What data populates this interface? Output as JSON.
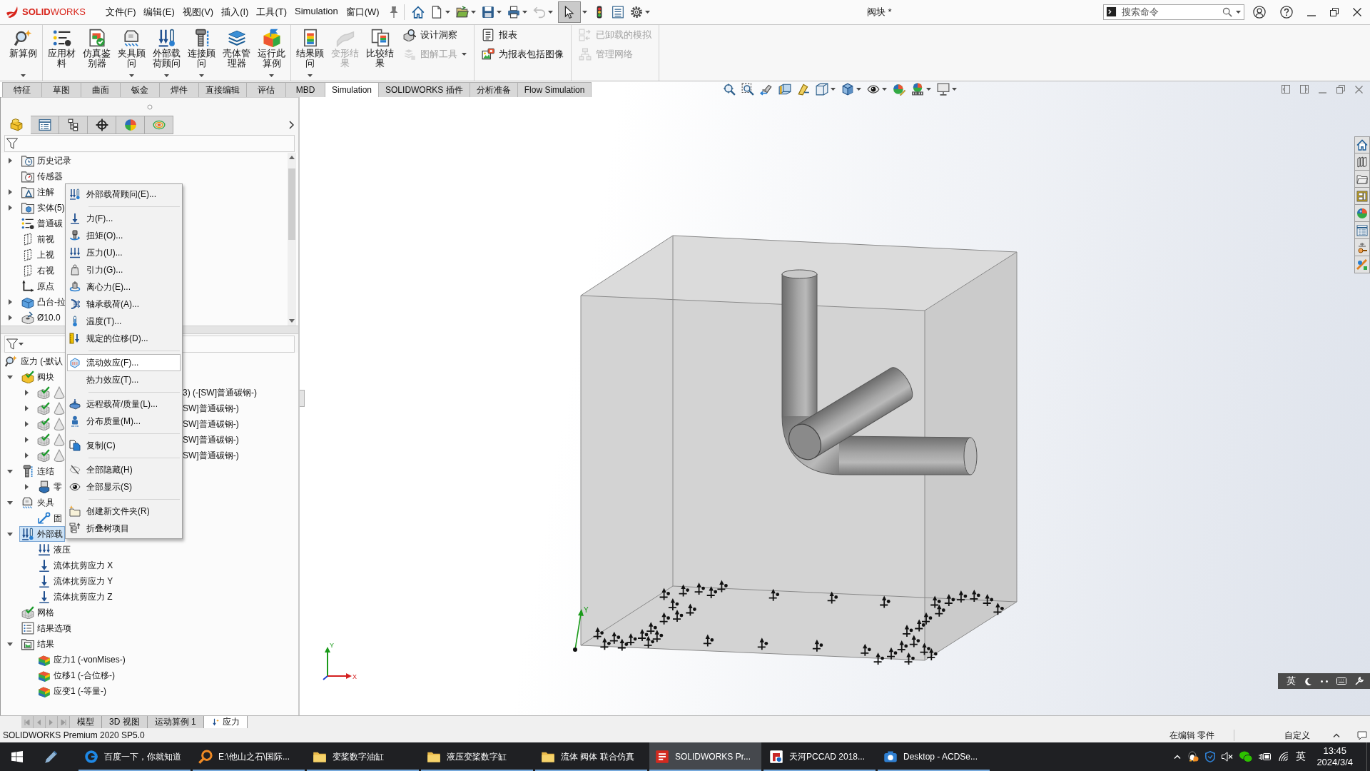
{
  "title_bar": {
    "logo": "**SOLID**WORKS",
    "menus": [
      "文件(F)",
      "编辑(E)",
      "视图(V)",
      "插入(I)",
      "工具(T)",
      "Simulation",
      "窗口(W)"
    ],
    "quick_access": [
      {
        "kind": "home",
        "dropdown": false,
        "disabled": false,
        "selected": false
      },
      {
        "kind": "new",
        "dropdown": true,
        "disabled": false,
        "selected": false
      },
      {
        "kind": "open",
        "dropdown": true,
        "disabled": false,
        "selected": false
      },
      {
        "kind": "save",
        "dropdown": true,
        "disabled": false,
        "selected": false
      },
      {
        "kind": "print",
        "dropdown": true,
        "disabled": false,
        "selected": false
      },
      {
        "kind": "undo",
        "dropdown": true,
        "disabled": true,
        "selected": false
      },
      {
        "kind": "select",
        "dropdown": true,
        "disabled": false,
        "selected": true
      },
      {
        "kind": "rebuild",
        "dropdown": false,
        "disabled": false,
        "selected": false
      },
      {
        "kind": "properties",
        "dropdown": false,
        "disabled": false,
        "selected": false
      },
      {
        "kind": "options",
        "dropdown": true,
        "disabled": false,
        "selected": false
      }
    ],
    "document_title": "阀块 *",
    "search": {
      "placeholder": "搜索命令"
    }
  },
  "ribbon": {
    "groups": [
      {
        "buttons": [
          {
            "label": "新算例",
            "kind": "study",
            "dropdown": true,
            "disabled": false
          }
        ]
      },
      {
        "buttons": [
          {
            "label": "应用材料",
            "kind": "material",
            "dropdown": false,
            "disabled": false
          },
          {
            "label": "仿真鉴别器",
            "kind": "evaluator",
            "dropdown": false,
            "disabled": false
          },
          {
            "label": "夹具顾问",
            "kind": "fixtures",
            "dropdown": true,
            "disabled": false
          },
          {
            "label": "外部载荷顾问",
            "kind": "loads",
            "dropdown": true,
            "disabled": false
          },
          {
            "label": "连接顾问",
            "kind": "connections",
            "dropdown": true,
            "disabled": false
          },
          {
            "label": "壳体管理器",
            "kind": "shells",
            "dropdown": false,
            "disabled": false
          },
          {
            "label": "运行此算例",
            "kind": "run",
            "dropdown": true,
            "disabled": false
          }
        ]
      },
      {
        "buttons": [
          {
            "label": "结果顾问",
            "kind": "resultsadvisor",
            "dropdown": true,
            "disabled": false
          },
          {
            "label": "变形结果",
            "kind": "deformed",
            "dropdown": false,
            "disabled": true
          },
          {
            "label": "比较结果",
            "kind": "compare",
            "dropdown": false,
            "disabled": false
          }
        ],
        "stack": [
          {
            "label": "设计洞察",
            "kind": "insight",
            "dropdown": false,
            "disabled": false
          },
          {
            "label": "图解工具",
            "kind": "plottools",
            "dropdown": true,
            "disabled": true
          }
        ]
      },
      {
        "stack": [
          {
            "label": "报表",
            "kind": "report",
            "dropdown": false,
            "disabled": false
          },
          {
            "label": "为报表包括图像",
            "kind": "image",
            "dropdown": false,
            "disabled": false
          }
        ]
      },
      {
        "stack": [
          {
            "label": "已卸载的模拟",
            "kind": "offloaded",
            "dropdown": false,
            "disabled": true
          },
          {
            "label": "管理网络",
            "kind": "network",
            "dropdown": false,
            "disabled": true
          }
        ]
      }
    ]
  },
  "command_tabs": [
    {
      "label": "特征",
      "selected": false
    },
    {
      "label": "草图",
      "selected": false
    },
    {
      "label": "曲面",
      "selected": false
    },
    {
      "label": "钣金",
      "selected": false
    },
    {
      "label": "焊件",
      "selected": false
    },
    {
      "label": "直接编辑",
      "selected": false
    },
    {
      "label": "评估",
      "selected": false
    },
    {
      "label": "MBD",
      "selected": false
    },
    {
      "label": "Simulation",
      "selected": true
    },
    {
      "label": "SOLIDWORKS 插件",
      "selected": false
    },
    {
      "label": "分析准备",
      "selected": false
    },
    {
      "label": "Flow Simulation",
      "selected": false
    }
  ],
  "feature_manager": {
    "tabs": [
      {
        "kind": "features",
        "selected": true
      },
      {
        "kind": "propertymanager",
        "selected": false
      },
      {
        "kind": "configurations",
        "selected": false
      },
      {
        "kind": "dimxpert",
        "selected": false
      },
      {
        "kind": "displaymanager",
        "selected": false
      },
      {
        "kind": "cam",
        "selected": false
      }
    ],
    "feature_tree": [
      {
        "label": "历史记录",
        "kind": "history",
        "expanded": false,
        "selected": false
      },
      {
        "label": "传感器",
        "kind": "sensors",
        "selected": false
      },
      {
        "label": "注解",
        "kind": "annotations",
        "expanded": false,
        "selected": false
      },
      {
        "label": "实体(5)",
        "kind": "bodies",
        "expanded": false,
        "selected": false
      },
      {
        "label": "普通碳",
        "kind": "material",
        "selected": false
      },
      {
        "label": "前视",
        "kind": "plane",
        "selected": false
      },
      {
        "label": "上视",
        "kind": "plane",
        "selected": false
      },
      {
        "label": "右视",
        "kind": "plane",
        "selected": false
      },
      {
        "label": "原点",
        "kind": "origin",
        "selected": false
      },
      {
        "label": "凸台-拉",
        "kind": "extrude",
        "expanded": false,
        "selected": false
      },
      {
        "label": "Ø10.0",
        "kind": "hole",
        "expanded": false,
        "selected": false
      }
    ],
    "study_tree": [
      {
        "label": "应力 (-默认",
        "kind": "study",
        "selected": false,
        "children": [
          {
            "label": "阀块",
            "kind": "part",
            "expanded": true,
            "selected": false,
            "children": [
              {
                "label": "3) (-[SW]普通碳钢-)",
                "kind": "body",
                "expanded": false,
                "selected": false
              },
              {
                "label": "SW]普通碳钢-)",
                "kind": "body",
                "expanded": false,
                "selected": false
              },
              {
                "label": "SW]普通碳钢-)",
                "kind": "body",
                "expanded": false,
                "selected": false
              },
              {
                "label": "SW]普通碳钢-)",
                "kind": "body",
                "expanded": false,
                "selected": false
              },
              {
                "label": "SW]普通碳钢-)",
                "kind": "body",
                "expanded": false,
                "selected": false
              }
            ]
          },
          {
            "label": "连结",
            "kind": "connections",
            "expanded": true,
            "selected": false,
            "children": [
              {
                "label": "零",
                "kind": "component",
                "expanded": false,
                "selected": false
              }
            ]
          },
          {
            "label": "夹具",
            "kind": "fixtures",
            "expanded": true,
            "selected": false,
            "children": [
              {
                "label": "固",
                "kind": "fixed",
                "selected": false
              }
            ]
          },
          {
            "label": "外部载",
            "kind": "loads",
            "expanded": true,
            "selected": true,
            "children": [
              {
                "label": "液压",
                "kind": "pressure",
                "selected": false
              },
              {
                "label": "流体抗剪应力 X",
                "kind": "force",
                "selected": false
              },
              {
                "label": "流体抗剪应力 Y",
                "kind": "force",
                "selected": false
              },
              {
                "label": "流体抗剪应力 Z",
                "kind": "force",
                "selected": false
              }
            ]
          },
          {
            "label": "网格",
            "kind": "mesh",
            "selected": false
          },
          {
            "label": "结果选项",
            "kind": "resultoptions",
            "selected": false
          },
          {
            "label": "结果",
            "kind": "results",
            "expanded": true,
            "selected": false,
            "children": [
              {
                "label": "应力1 (-vonMises-)",
                "kind": "plot",
                "selected": false
              },
              {
                "label": "位移1 (-合位移-)",
                "kind": "plot",
                "selected": false
              },
              {
                "label": "应变1 (-等量-)",
                "kind": "plot",
                "selected": false
              }
            ]
          }
        ]
      }
    ]
  },
  "context_menu": [
    {
      "label": "外部载荷顾问(E)...",
      "kind": "advisor",
      "selected": false
    },
    {
      "kind": "separator"
    },
    {
      "label": "力(F)...",
      "kind": "force",
      "selected": false
    },
    {
      "label": "扭矩(O)...",
      "kind": "torque",
      "selected": false
    },
    {
      "label": "压力(U)...",
      "kind": "pressure",
      "selected": false
    },
    {
      "label": "引力(G)...",
      "kind": "gravity",
      "selected": false
    },
    {
      "label": "离心力(E)...",
      "kind": "centrifugal",
      "selected": false
    },
    {
      "label": "轴承载荷(A)...",
      "kind": "bearing",
      "selected": false
    },
    {
      "label": "温度(T)...",
      "kind": "temperature",
      "selected": false
    },
    {
      "label": "规定的位移(D)...",
      "kind": "displacement",
      "selected": false
    },
    {
      "kind": "separator"
    },
    {
      "label": "流动效应(F)...",
      "kind": "flow",
      "selected": true
    },
    {
      "label": "热力效应(T)...",
      "kind": "thermal",
      "selected": false
    },
    {
      "kind": "separator"
    },
    {
      "label": "远程载荷/质量(L)...",
      "kind": "remote",
      "selected": false
    },
    {
      "label": "分布质量(M)...",
      "kind": "mass",
      "selected": false
    },
    {
      "kind": "separator"
    },
    {
      "label": "复制(C)",
      "kind": "copy",
      "selected": false
    },
    {
      "kind": "separator"
    },
    {
      "label": "全部隐藏(H)",
      "kind": "hide",
      "selected": false
    },
    {
      "label": "全部显示(S)",
      "kind": "show",
      "selected": false
    },
    {
      "kind": "separator"
    },
    {
      "label": "创建新文件夹(R)",
      "kind": "newfolder",
      "selected": false
    },
    {
      "label": "折叠树项目",
      "kind": "collapse",
      "selected": false
    }
  ],
  "viewport": {
    "reference_axis_label": "Y",
    "triad": {
      "x_label": "X",
      "y_label": "Y"
    }
  },
  "ime_bar": {
    "language": "英"
  },
  "bottom_tabs": [
    {
      "label": "模型",
      "kind": "model",
      "selected": false
    },
    {
      "label": "3D 视图",
      "kind": "view",
      "selected": false
    },
    {
      "label": "运动算例 1",
      "kind": "motion",
      "selected": false
    },
    {
      "label": "应力",
      "kind": "study",
      "selected": true
    }
  ],
  "status_bar": {
    "product": "SOLIDWORKS Premium 2020 SP5.0",
    "mode": "在编辑 零件",
    "units": "自定义"
  },
  "taskbar": {
    "apps": [
      {
        "label": "百度一下，你就知道",
        "kind": "browser",
        "selected": false
      },
      {
        "label": "E:\\他山之石\\国际...",
        "kind": "finder",
        "selected": false
      },
      {
        "label": "变桨数字油缸",
        "kind": "folder",
        "selected": false
      },
      {
        "label": "液压变桨数字缸",
        "kind": "folder",
        "selected": false
      },
      {
        "label": "流体 阀体 联合仿真",
        "kind": "folder",
        "selected": false
      },
      {
        "label": "SOLIDWORKS Pr...",
        "kind": "solidworks",
        "selected": true
      },
      {
        "label": "天河PCCAD 2018...",
        "kind": "pccad",
        "selected": false
      },
      {
        "label": "Desktop - ACDSe...",
        "kind": "viewer",
        "selected": false
      }
    ],
    "ime": "英",
    "time": "13:45",
    "date": "2024/3/4"
  }
}
